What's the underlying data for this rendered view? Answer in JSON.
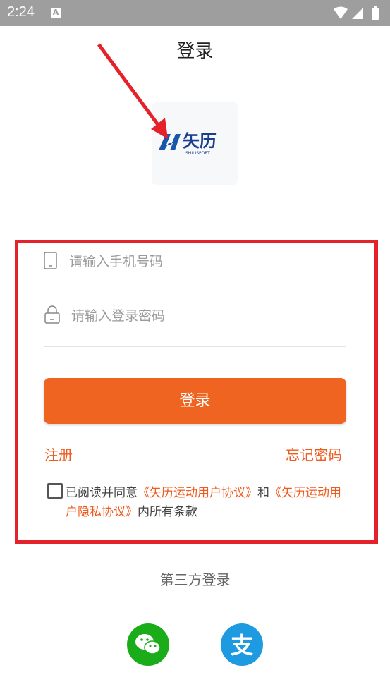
{
  "status_bar": {
    "time": "2:24",
    "notification_glyph": "A"
  },
  "page": {
    "title": "登录"
  },
  "logo": {
    "brand_text": "矢历",
    "sub_text": "SHILISPORT"
  },
  "form": {
    "phone_placeholder": "请输入手机号码",
    "password_placeholder": "请输入登录密码",
    "login_button": "登录"
  },
  "links": {
    "register": "注册",
    "forgot_password": "忘记密码"
  },
  "agreement": {
    "prefix": "已阅读并同意",
    "user_agreement": "《矢历运动用户协议》",
    "and": "和",
    "privacy_agreement": "《矢历运动用户隐私协议》",
    "suffix": "内所有条款"
  },
  "third_party": {
    "label": "第三方登录",
    "providers": [
      "wechat-icon",
      "alipay-icon"
    ]
  },
  "colors": {
    "accent": "#f06422",
    "highlight_box": "#e5212a",
    "wechat": "#1aad19",
    "alipay": "#1e9be0"
  }
}
